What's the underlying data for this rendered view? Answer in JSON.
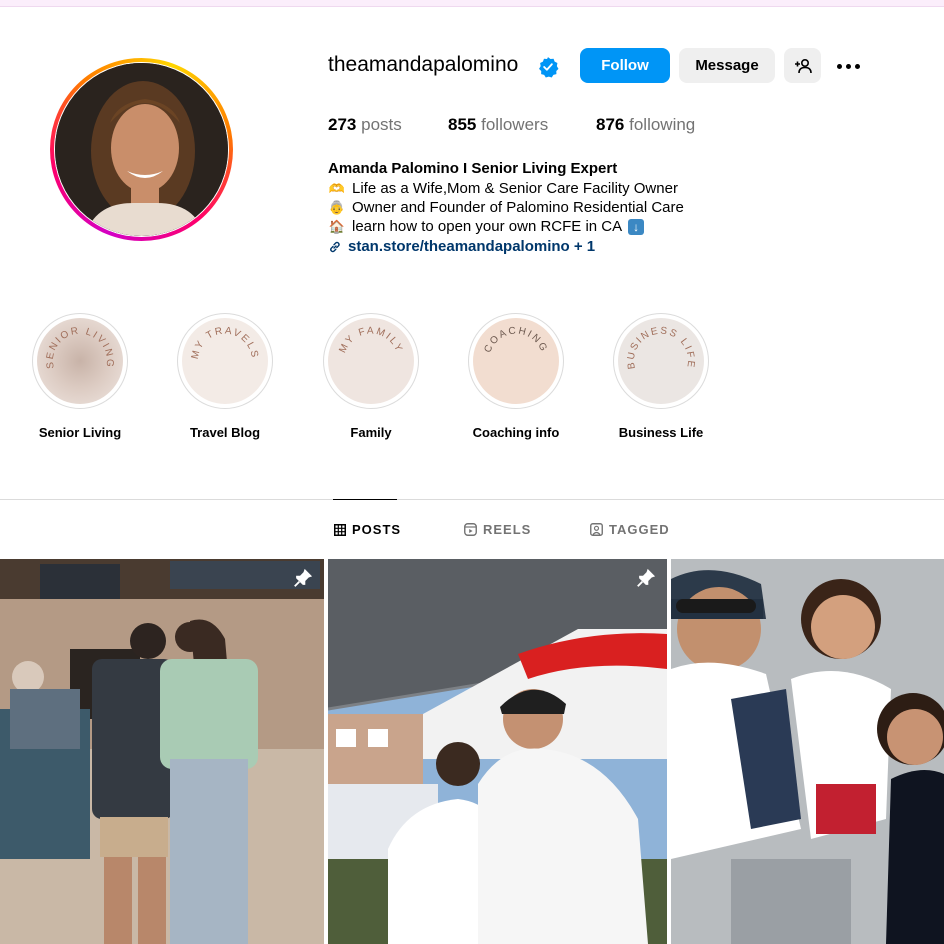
{
  "profile": {
    "username": "theamandapalomino",
    "follow_label": "Follow",
    "message_label": "Message"
  },
  "stats": {
    "posts_count": "273",
    "posts_label": "posts",
    "followers_count": "855",
    "followers_label": "followers",
    "following_count": "876",
    "following_label": "following"
  },
  "bio": {
    "name": "Amanda Palomino I Senior Living Expert",
    "line1": "Life as a Wife,Mom & Senior Care Facility Owner",
    "line2": "Owner and Founder of Palomino Residential Care",
    "line3": "learn how to open your own RCFE in CA",
    "link": "stan.store/theamandapalomino + 1"
  },
  "highlights": [
    {
      "label": "Senior Living",
      "cover_text": "SENIOR LIVING"
    },
    {
      "label": "Travel Blog",
      "cover_text": "MY TRAVELS"
    },
    {
      "label": "Family",
      "cover_text": "MY FAMILY"
    },
    {
      "label": "Coaching info",
      "cover_text": "COACHING"
    },
    {
      "label": "Business Life",
      "cover_text": "BUSINESS LIFE"
    }
  ],
  "tabs": {
    "posts": "POSTS",
    "reels": "REELS",
    "tagged": "TAGGED"
  },
  "colors": {
    "follow_button": "#0095f6",
    "verified_badge": "#0095f6",
    "link": "#00376b"
  },
  "posts": [
    {
      "pinned": true
    },
    {
      "pinned": true
    },
    {
      "pinned": false
    }
  ]
}
